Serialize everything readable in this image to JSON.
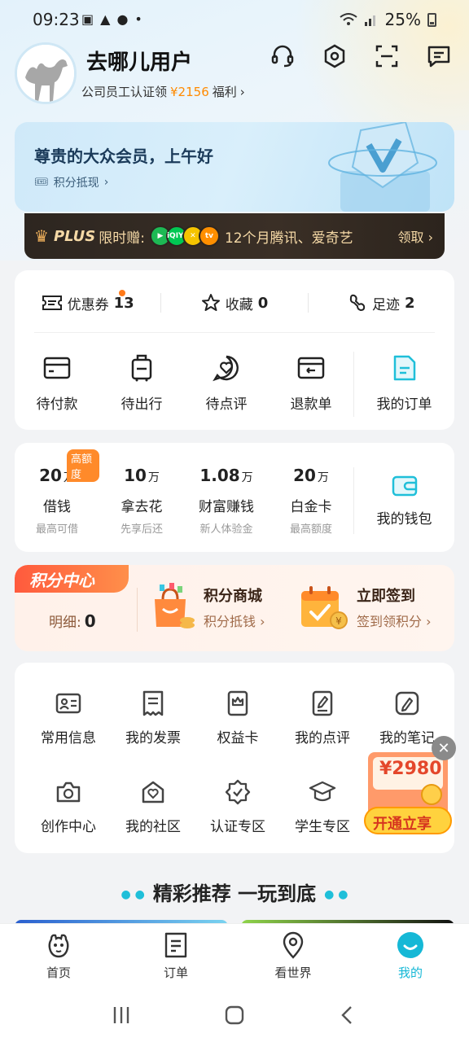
{
  "status_bar": {
    "time": "09:23",
    "battery": "25%"
  },
  "header": {
    "username": "去哪儿用户",
    "subtitle_prefix": "公司员工认证领",
    "subtitle_amount": "¥2156",
    "subtitle_suffix": "福利",
    "icons": [
      "headset-icon",
      "settings-hex-icon",
      "scan-icon",
      "message-icon"
    ]
  },
  "member": {
    "greeting": "尊贵的大众会员，上午好",
    "points_link": "积分抵现"
  },
  "plus": {
    "brand": "PLUS",
    "limited": "限时赠:",
    "desc": "12个月腾讯、爱奇艺",
    "claim": "领取",
    "apps": [
      {
        "label": "▶",
        "color": "#1db954"
      },
      {
        "label": "iQIYI",
        "color": "#00c853"
      },
      {
        "label": "✕",
        "color": "#f5c400"
      },
      {
        "label": "tv",
        "color": "#ff8f00"
      }
    ]
  },
  "stats": [
    {
      "label": "优惠券",
      "value": "13"
    },
    {
      "label": "收藏",
      "value": "0"
    },
    {
      "label": "足迹",
      "value": "2"
    }
  ],
  "orders": [
    {
      "label": "待付款"
    },
    {
      "label": "待出行"
    },
    {
      "label": "待点评"
    },
    {
      "label": "退款单"
    },
    {
      "label": "我的订单"
    }
  ],
  "wallet": {
    "items": [
      {
        "num": "20",
        "unit": "万",
        "label": "借钱",
        "sub": "最高可借"
      },
      {
        "num": "10",
        "unit": "万",
        "label": "拿去花",
        "sub": "先享后还"
      },
      {
        "num": "1.08",
        "unit": "万",
        "label": "财富赚钱",
        "sub": "新人体验金"
      },
      {
        "num": "20",
        "unit": "万",
        "label": "白金卡",
        "sub": "最高额度"
      }
    ],
    "badge": "高额度",
    "mine": "我的钱包"
  },
  "points": {
    "tag": "积分中心",
    "detail_label": "明细:",
    "detail_value": "0",
    "mall_title": "积分商城",
    "mall_sub": "积分抵钱",
    "sign_title": "立即签到",
    "sign_sub": "签到领积分"
  },
  "tools": [
    {
      "label": "常用信息"
    },
    {
      "label": "我的发票"
    },
    {
      "label": "权益卡"
    },
    {
      "label": "我的点评"
    },
    {
      "label": "我的笔记"
    },
    {
      "label": "创作中心"
    },
    {
      "label": "我的社区"
    },
    {
      "label": "认证专区"
    },
    {
      "label": "学生专区"
    }
  ],
  "promo": {
    "amount": "¥2980",
    "button": "开通立享"
  },
  "section": {
    "title": "精彩推荐 一玩到底"
  },
  "tabs": [
    {
      "label": "首页"
    },
    {
      "label": "订单"
    },
    {
      "label": "看世界"
    },
    {
      "label": "我的"
    }
  ],
  "colors": {
    "accent": "#15b8d6",
    "orange": "#ff8a00"
  }
}
